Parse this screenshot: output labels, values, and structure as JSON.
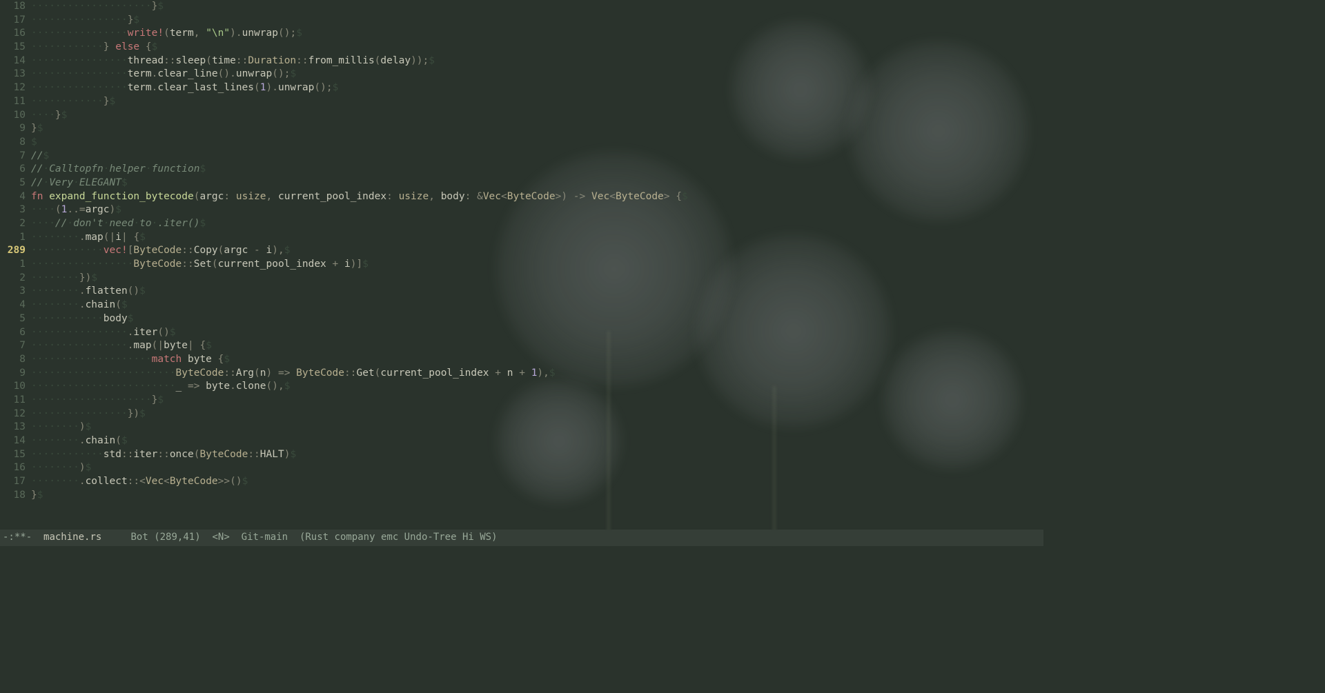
{
  "modeline": {
    "status": "-:**-",
    "filename": "machine.rs",
    "position": "Bot",
    "cursor": "(289,41)",
    "mode_n": "<N>",
    "vc": "Git-main",
    "modes": "(Rust company emc Undo-Tree Hi WS)"
  },
  "cursor_line": 289,
  "lines": [
    {
      "rel": "18",
      "indent": 20,
      "tokens": [
        {
          "c": "punct",
          "t": "}"
        }
      ]
    },
    {
      "rel": "17",
      "indent": 16,
      "tokens": [
        {
          "c": "punct",
          "t": "}"
        }
      ]
    },
    {
      "rel": "16",
      "indent": 16,
      "tokens": [
        {
          "c": "macro",
          "t": "write!"
        },
        {
          "c": "punct",
          "t": "("
        },
        {
          "c": "ident",
          "t": "term"
        },
        {
          "c": "punct",
          "t": ", "
        },
        {
          "c": "string",
          "t": "\"\\n\""
        },
        {
          "c": "punct",
          "t": ")."
        },
        {
          "c": "ident",
          "t": "unwrap"
        },
        {
          "c": "punct",
          "t": "();"
        }
      ]
    },
    {
      "rel": "15",
      "indent": 12,
      "tokens": [
        {
          "c": "punct",
          "t": "} "
        },
        {
          "c": "kw",
          "t": "else"
        },
        {
          "c": "punct",
          "t": " {"
        }
      ]
    },
    {
      "rel": "14",
      "indent": 16,
      "tokens": [
        {
          "c": "ident",
          "t": "thread"
        },
        {
          "c": "punct",
          "t": "::"
        },
        {
          "c": "ident",
          "t": "sleep"
        },
        {
          "c": "punct",
          "t": "("
        },
        {
          "c": "ident",
          "t": "time"
        },
        {
          "c": "punct",
          "t": "::"
        },
        {
          "c": "type",
          "t": "Duration"
        },
        {
          "c": "punct",
          "t": "::"
        },
        {
          "c": "ident",
          "t": "from_millis"
        },
        {
          "c": "punct",
          "t": "("
        },
        {
          "c": "ident",
          "t": "delay"
        },
        {
          "c": "punct",
          "t": "));"
        }
      ]
    },
    {
      "rel": "13",
      "indent": 16,
      "tokens": [
        {
          "c": "ident",
          "t": "term"
        },
        {
          "c": "punct",
          "t": "."
        },
        {
          "c": "ident",
          "t": "clear_line"
        },
        {
          "c": "punct",
          "t": "()."
        },
        {
          "c": "ident",
          "t": "unwrap"
        },
        {
          "c": "punct",
          "t": "();"
        }
      ]
    },
    {
      "rel": "12",
      "indent": 16,
      "tokens": [
        {
          "c": "ident",
          "t": "term"
        },
        {
          "c": "punct",
          "t": "."
        },
        {
          "c": "ident",
          "t": "clear_last_lines"
        },
        {
          "c": "punct",
          "t": "("
        },
        {
          "c": "num",
          "t": "1"
        },
        {
          "c": "punct",
          "t": ")."
        },
        {
          "c": "ident",
          "t": "unwrap"
        },
        {
          "c": "punct",
          "t": "();"
        }
      ]
    },
    {
      "rel": "11",
      "indent": 12,
      "tokens": [
        {
          "c": "punct",
          "t": "}"
        }
      ]
    },
    {
      "rel": "10",
      "indent": 4,
      "tokens": [
        {
          "c": "punct",
          "t": "}"
        }
      ]
    },
    {
      "rel": "9",
      "indent": 0,
      "tokens": [
        {
          "c": "punct",
          "t": "}"
        }
      ]
    },
    {
      "rel": "8",
      "indent": 0,
      "tokens": []
    },
    {
      "rel": "7",
      "indent": 0,
      "tokens": [
        {
          "c": "comment",
          "t": "//"
        }
      ]
    },
    {
      "rel": "6",
      "indent": 0,
      "tokens": [
        {
          "c": "comment",
          "t": "// Calltopfn helper function"
        }
      ]
    },
    {
      "rel": "5",
      "indent": 0,
      "tokens": [
        {
          "c": "comment",
          "t": "// Very ELEGANT"
        }
      ]
    },
    {
      "rel": "4",
      "indent": 0,
      "tokens": [
        {
          "c": "kw",
          "t": "fn"
        },
        {
          "c": "ident",
          "t": " "
        },
        {
          "c": "fn-name",
          "t": "expand_function_bytecode"
        },
        {
          "c": "punct",
          "t": "("
        },
        {
          "c": "ident",
          "t": "argc"
        },
        {
          "c": "punct",
          "t": ": "
        },
        {
          "c": "type",
          "t": "usize"
        },
        {
          "c": "punct",
          "t": ", "
        },
        {
          "c": "ident",
          "t": "current_pool_index"
        },
        {
          "c": "punct",
          "t": ": "
        },
        {
          "c": "type",
          "t": "usize"
        },
        {
          "c": "punct",
          "t": ", "
        },
        {
          "c": "ident",
          "t": "body"
        },
        {
          "c": "punct",
          "t": ": &"
        },
        {
          "c": "type",
          "t": "Vec"
        },
        {
          "c": "punct",
          "t": "<"
        },
        {
          "c": "type",
          "t": "ByteCode"
        },
        {
          "c": "punct",
          "t": ">) -> "
        },
        {
          "c": "type",
          "t": "Vec"
        },
        {
          "c": "punct",
          "t": "<"
        },
        {
          "c": "type",
          "t": "ByteCode"
        },
        {
          "c": "punct",
          "t": "> {"
        }
      ]
    },
    {
      "rel": "3",
      "indent": 4,
      "tokens": [
        {
          "c": "punct",
          "t": "("
        },
        {
          "c": "num",
          "t": "1"
        },
        {
          "c": "punct",
          "t": "..="
        },
        {
          "c": "ident",
          "t": "argc"
        },
        {
          "c": "punct",
          "t": ")"
        }
      ]
    },
    {
      "rel": "2",
      "indent": 4,
      "tokens": [
        {
          "c": "comment",
          "t": "// don't need to .iter()"
        }
      ]
    },
    {
      "rel": "1",
      "indent": 8,
      "tokens": [
        {
          "c": "punct",
          "t": "."
        },
        {
          "c": "ident",
          "t": "map"
        },
        {
          "c": "punct",
          "t": "(|"
        },
        {
          "c": "ident",
          "t": "i"
        },
        {
          "c": "punct",
          "t": "| {"
        }
      ]
    },
    {
      "rel": "289",
      "current": true,
      "indent": 12,
      "tokens": [
        {
          "c": "macro",
          "t": "vec!"
        },
        {
          "c": "punct",
          "t": "["
        },
        {
          "c": "type",
          "t": "ByteCode"
        },
        {
          "c": "punct",
          "t": "::"
        },
        {
          "c": "ident",
          "t": "Copy"
        },
        {
          "c": "punct",
          "t": "("
        },
        {
          "c": "ident",
          "t": "argc"
        },
        {
          "c": "punct",
          "t": " - "
        },
        {
          "c": "ident",
          "t": "i"
        },
        {
          "c": "punct",
          "t": "),"
        }
      ]
    },
    {
      "rel": "1",
      "indent": 17,
      "tokens": [
        {
          "c": "type",
          "t": "ByteCode"
        },
        {
          "c": "punct",
          "t": "::"
        },
        {
          "c": "ident",
          "t": "Set"
        },
        {
          "c": "punct",
          "t": "("
        },
        {
          "c": "ident",
          "t": "current_pool_index"
        },
        {
          "c": "punct",
          "t": " + "
        },
        {
          "c": "ident",
          "t": "i"
        },
        {
          "c": "punct",
          "t": ")]"
        }
      ]
    },
    {
      "rel": "2",
      "indent": 8,
      "tokens": [
        {
          "c": "punct",
          "t": "})"
        }
      ]
    },
    {
      "rel": "3",
      "indent": 8,
      "tokens": [
        {
          "c": "punct",
          "t": "."
        },
        {
          "c": "ident",
          "t": "flatten"
        },
        {
          "c": "punct",
          "t": "()"
        }
      ]
    },
    {
      "rel": "4",
      "indent": 8,
      "tokens": [
        {
          "c": "punct",
          "t": "."
        },
        {
          "c": "ident",
          "t": "chain"
        },
        {
          "c": "punct",
          "t": "("
        }
      ]
    },
    {
      "rel": "5",
      "indent": 12,
      "tokens": [
        {
          "c": "ident",
          "t": "body"
        }
      ]
    },
    {
      "rel": "6",
      "indent": 16,
      "tokens": [
        {
          "c": "punct",
          "t": "."
        },
        {
          "c": "ident",
          "t": "iter"
        },
        {
          "c": "punct",
          "t": "()"
        }
      ]
    },
    {
      "rel": "7",
      "indent": 16,
      "tokens": [
        {
          "c": "punct",
          "t": "."
        },
        {
          "c": "ident",
          "t": "map"
        },
        {
          "c": "punct",
          "t": "(|"
        },
        {
          "c": "ident",
          "t": "byte"
        },
        {
          "c": "punct",
          "t": "| {"
        }
      ]
    },
    {
      "rel": "8",
      "indent": 20,
      "tokens": [
        {
          "c": "kw",
          "t": "match"
        },
        {
          "c": "ident",
          "t": " byte "
        },
        {
          "c": "punct",
          "t": "{"
        }
      ]
    },
    {
      "rel": "9",
      "indent": 24,
      "tokens": [
        {
          "c": "type",
          "t": "ByteCode"
        },
        {
          "c": "punct",
          "t": "::"
        },
        {
          "c": "ident",
          "t": "Arg"
        },
        {
          "c": "punct",
          "t": "("
        },
        {
          "c": "ident",
          "t": "n"
        },
        {
          "c": "punct",
          "t": ") => "
        },
        {
          "c": "type",
          "t": "ByteCode"
        },
        {
          "c": "punct",
          "t": "::"
        },
        {
          "c": "ident",
          "t": "Get"
        },
        {
          "c": "punct",
          "t": "("
        },
        {
          "c": "ident",
          "t": "current_pool_index"
        },
        {
          "c": "punct",
          "t": " + "
        },
        {
          "c": "ident",
          "t": "n"
        },
        {
          "c": "punct",
          "t": " + "
        },
        {
          "c": "num",
          "t": "1"
        },
        {
          "c": "punct",
          "t": "),"
        }
      ]
    },
    {
      "rel": "10",
      "indent": 24,
      "tokens": [
        {
          "c": "ident",
          "t": "_"
        },
        {
          "c": "punct",
          "t": " => "
        },
        {
          "c": "ident",
          "t": "byte"
        },
        {
          "c": "punct",
          "t": "."
        },
        {
          "c": "ident",
          "t": "clone"
        },
        {
          "c": "punct",
          "t": "(),"
        }
      ]
    },
    {
      "rel": "11",
      "indent": 20,
      "tokens": [
        {
          "c": "punct",
          "t": "}"
        }
      ]
    },
    {
      "rel": "12",
      "indent": 16,
      "tokens": [
        {
          "c": "punct",
          "t": "})"
        }
      ]
    },
    {
      "rel": "13",
      "indent": 8,
      "tokens": [
        {
          "c": "punct",
          "t": ")"
        }
      ]
    },
    {
      "rel": "14",
      "indent": 8,
      "tokens": [
        {
          "c": "punct",
          "t": "."
        },
        {
          "c": "ident",
          "t": "chain"
        },
        {
          "c": "punct",
          "t": "("
        }
      ]
    },
    {
      "rel": "15",
      "indent": 12,
      "tokens": [
        {
          "c": "ident",
          "t": "std"
        },
        {
          "c": "punct",
          "t": "::"
        },
        {
          "c": "ident",
          "t": "iter"
        },
        {
          "c": "punct",
          "t": "::"
        },
        {
          "c": "ident",
          "t": "once"
        },
        {
          "c": "punct",
          "t": "("
        },
        {
          "c": "type",
          "t": "ByteCode"
        },
        {
          "c": "punct",
          "t": "::"
        },
        {
          "c": "ident",
          "t": "HALT"
        },
        {
          "c": "punct",
          "t": ")"
        }
      ]
    },
    {
      "rel": "16",
      "indent": 8,
      "tokens": [
        {
          "c": "punct",
          "t": ")"
        }
      ]
    },
    {
      "rel": "17",
      "indent": 8,
      "tokens": [
        {
          "c": "punct",
          "t": "."
        },
        {
          "c": "ident",
          "t": "collect"
        },
        {
          "c": "punct",
          "t": "::<"
        },
        {
          "c": "type",
          "t": "Vec"
        },
        {
          "c": "punct",
          "t": "<"
        },
        {
          "c": "type",
          "t": "ByteCode"
        },
        {
          "c": "punct",
          "t": ">>()"
        }
      ]
    },
    {
      "rel": "18",
      "indent": 0,
      "tokens": [
        {
          "c": "punct",
          "t": "}"
        }
      ]
    }
  ]
}
